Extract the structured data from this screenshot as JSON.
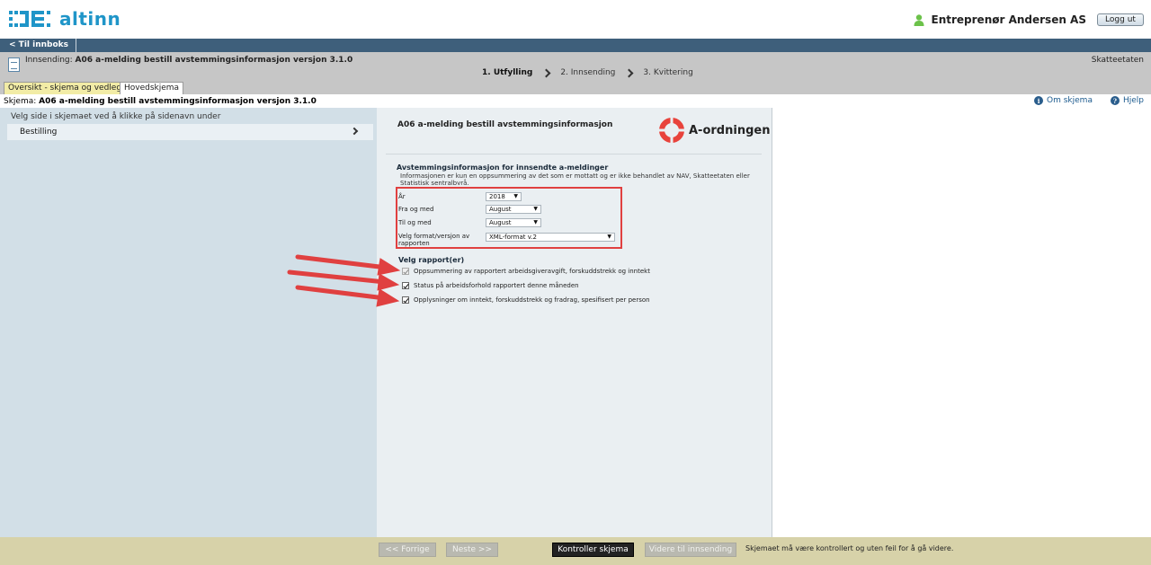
{
  "header": {
    "logo_text": "altinn",
    "user_name": "Entreprenør Andersen AS",
    "logout_label": "Logg ut"
  },
  "nav": {
    "back_label": "< Til innboks"
  },
  "submission": {
    "prefix": "Innsending:",
    "title": "A06 a-melding bestill avstemmingsinformasjon versjon 3.1.0",
    "agency": "Skatteetaten",
    "steps": [
      "1. Utfylling",
      "2. Innsending",
      "3. Kvittering"
    ],
    "tabs": [
      "Oversikt - skjema og vedlegg",
      "Hovedskjema"
    ]
  },
  "schema": {
    "prefix": "Skjema:",
    "title": "A06 a-melding bestill avstemmingsinformasjon versjon 3.1.0",
    "about_label": "Om skjema",
    "help_label": "Hjelp"
  },
  "sidebar": {
    "intro": "Velg side i skjemaet ved å klikke på sidenavn under",
    "pages": [
      "Bestilling"
    ]
  },
  "form": {
    "title": "A06 a-melding bestill avstemmingsinformasjon",
    "brand": "A-ordningen",
    "section_title": "Avstemmingsinformasjon for innsendte a-meldinger",
    "section_desc": "Informasjonen er kun en oppsummering av det som er mottatt og er ikke behandlet av NAV, Skatteetaten eller Statistisk sentralbyrå.",
    "fields": {
      "year_label": "År",
      "year_value": "2018",
      "from_label": "Fra og med",
      "from_value": "August",
      "to_label": "Til og med",
      "to_value": "August",
      "format_label_1": "Velg format/versjon av",
      "format_label_2": "rapporten",
      "format_value": "XML-format v.2"
    },
    "reports_title": "Velg rapport(er)",
    "reports": [
      {
        "label": "Oppsummering av rapportert arbeidsgiveravgift, forskuddstrekk og inntekt",
        "checked": true,
        "disabled": true
      },
      {
        "label": "Status på arbeidsforhold rapportert denne måneden",
        "checked": true,
        "disabled": false
      },
      {
        "label": "Opplysninger om inntekt, forskuddstrekk og fradrag, spesifisert per person",
        "checked": true,
        "disabled": false
      }
    ]
  },
  "footer": {
    "prev_label": "<< Forrige",
    "next_label": "Neste >>",
    "check_label": "Kontroller skjema",
    "submit_label": "Videre til innsending",
    "message": "Skjemaet må være kontrollert og uten feil for å gå videre."
  },
  "colors": {
    "brand_blue": "#1f95c8",
    "nav_blue": "#3e5f7b",
    "annotation_red": "#e04040",
    "aord_red": "#e8433c",
    "user_green": "#6cc24a"
  },
  "icons": {
    "user": "person-icon",
    "doc": "document-icon",
    "info": "info-icon",
    "help": "help-icon"
  }
}
